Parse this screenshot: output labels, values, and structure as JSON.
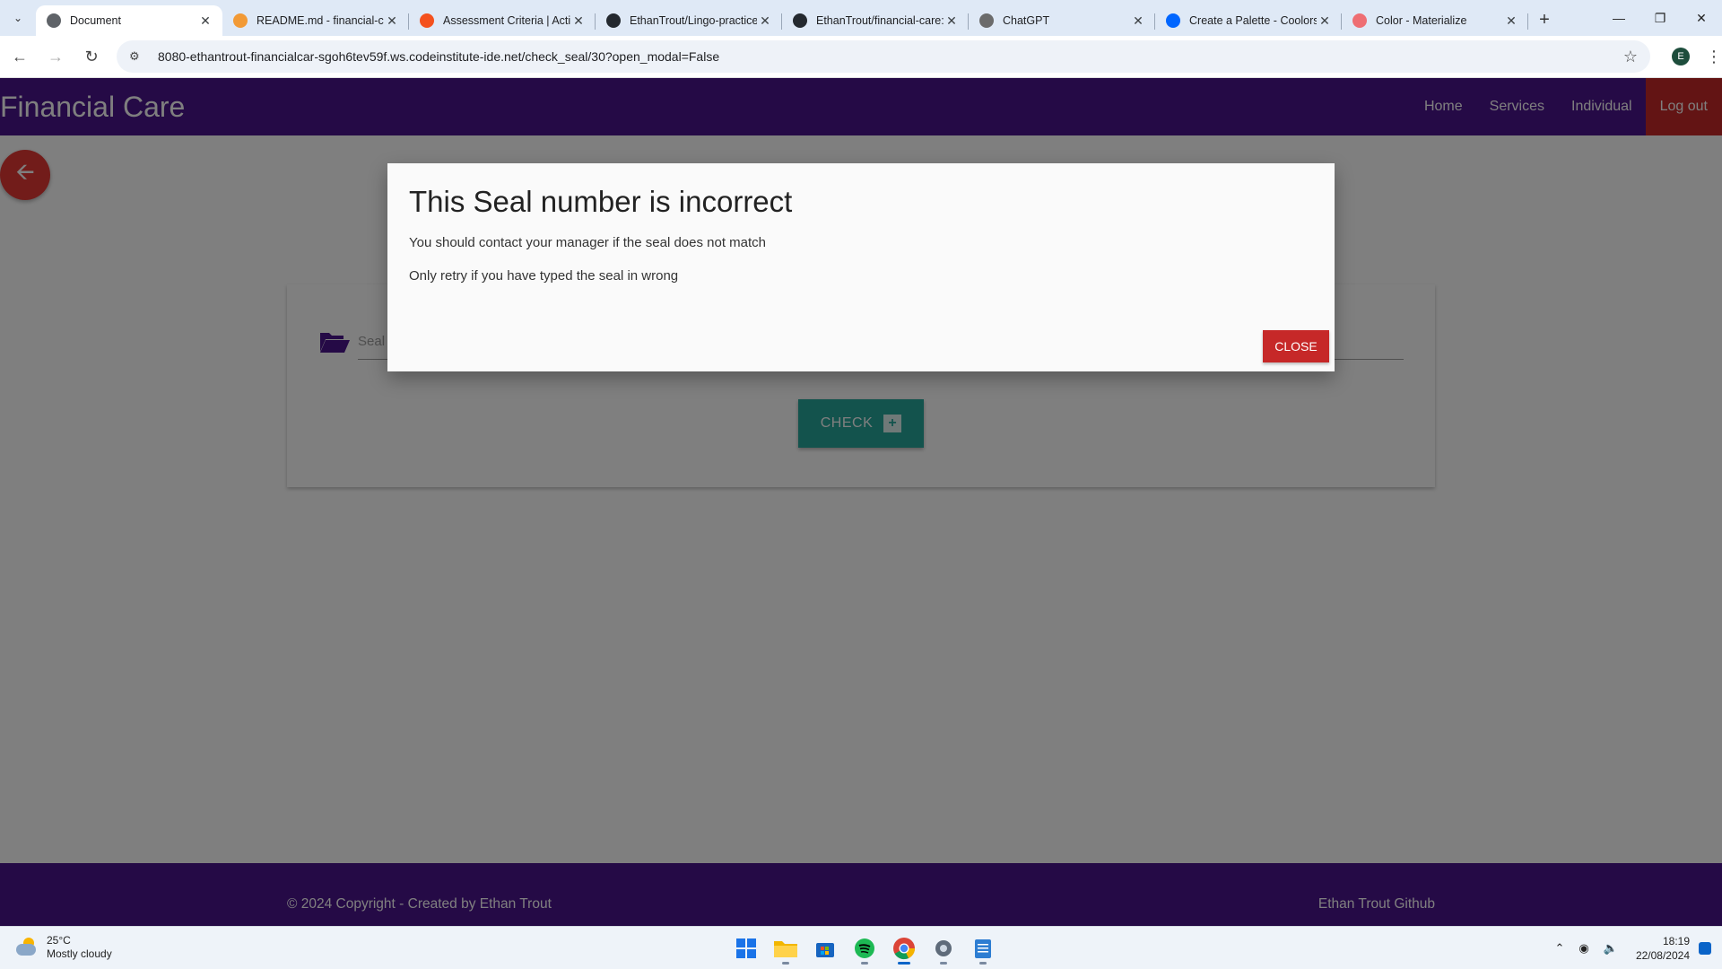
{
  "browser": {
    "tabs": [
      {
        "title": "Document",
        "icon": "globe-icon",
        "color": "#5f6368",
        "active": true
      },
      {
        "title": "README.md - financial-ca",
        "icon": "gitpod-icon",
        "color": "#f29a36",
        "active": false
      },
      {
        "title": "Assessment Criteria | Acti",
        "icon": "circle-icon",
        "color": "#f4511e",
        "active": false
      },
      {
        "title": "EthanTrout/Lingo-practice",
        "icon": "github-icon",
        "color": "#24292f",
        "active": false
      },
      {
        "title": "EthanTrout/financial-care:",
        "icon": "github-icon",
        "color": "#24292f",
        "active": false
      },
      {
        "title": "ChatGPT",
        "icon": "chatgpt-icon",
        "color": "#6b6b6b",
        "active": false
      },
      {
        "title": "Create a Palette - Coolors",
        "icon": "coolors-icon",
        "color": "#0066ff",
        "active": false
      },
      {
        "title": "Color - Materialize",
        "icon": "materialize-icon",
        "color": "#ee6e73",
        "active": false
      }
    ],
    "url": "8080-ethantrout-financialcar-sgoh6tev59f.ws.codeinstitute-ide.net/check_seal/30?open_modal=False",
    "profile_initial": "E"
  },
  "site": {
    "brand": "Financial Care",
    "nav": [
      "Home",
      "Services",
      "Individual",
      "Log out"
    ],
    "seal_placeholder": "Seal",
    "check_label": "CHECK",
    "footer_copy": "© 2024 Copyright - Created by Ethan Trout",
    "footer_link": "Ethan Trout Github",
    "colors": {
      "primary": "#4a148c",
      "accent": "#c62828",
      "teal": "#26a69a"
    }
  },
  "modal": {
    "title": "This Seal number is incorrect",
    "line1": "You should contact your manager if the seal does not match",
    "line2": "Only retry if you have typed the seal in wrong",
    "close_label": "CLOSE"
  },
  "taskbar": {
    "temp": "25°C",
    "weather": "Mostly cloudy",
    "time": "18:19",
    "date": "22/08/2024"
  }
}
